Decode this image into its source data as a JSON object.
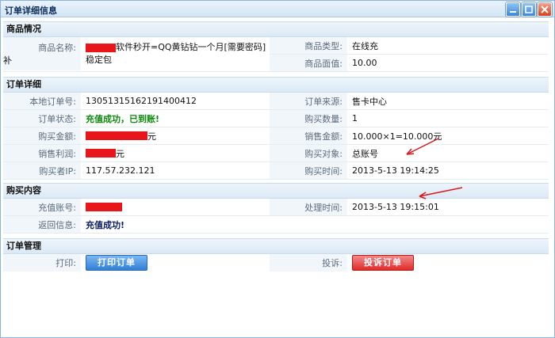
{
  "window": {
    "title": "订单详细信息"
  },
  "sections": {
    "product": {
      "header": "商品情况",
      "name_label": "商品名称:",
      "name_value": "软件秒开=QQ黄钻钻一个月[需要密码] 稳定包",
      "name_wrap": "补",
      "type_label": "商品类型:",
      "type_value": "在线充",
      "face_label": "商品面值:",
      "face_value": "10.00"
    },
    "order": {
      "header": "订单详细",
      "local_no_label": "本地订单号:",
      "local_no_value": "13051315162191400412",
      "source_label": "订单来源:",
      "source_value": "售卡中心",
      "status_label": "订单状态:",
      "status_value": "充值成功，已到账!",
      "qty_label": "购买数量:",
      "qty_value": "1",
      "amount_label": "购买金额:",
      "amount_suffix": "元",
      "sale_amount_label": "销售金额:",
      "sale_amount_value": "10.000×1=10.000元",
      "profit_label": "销售利润:",
      "profit_suffix": "元",
      "target_label": "购买对象:",
      "target_value": "总账号",
      "ip_label": "购买者IP:",
      "ip_value": "117.57.232.121",
      "time_label": "购买时间:",
      "time_value": "2013-5-13 19:14:25"
    },
    "content": {
      "header": "购买内容",
      "account_label": "充值账号:",
      "process_label": "处理时间:",
      "process_value": "2013-5-13 19:15:01",
      "return_label": "返回信息:",
      "return_value": "充值成功!"
    },
    "manage": {
      "header": "订单管理",
      "print_label": "打印:",
      "print_button": "打印订单",
      "complain_label": "投诉:",
      "complain_button": "投诉订单"
    }
  },
  "colors": {
    "redact": "#e8151b",
    "arrow": "#d8191b"
  }
}
